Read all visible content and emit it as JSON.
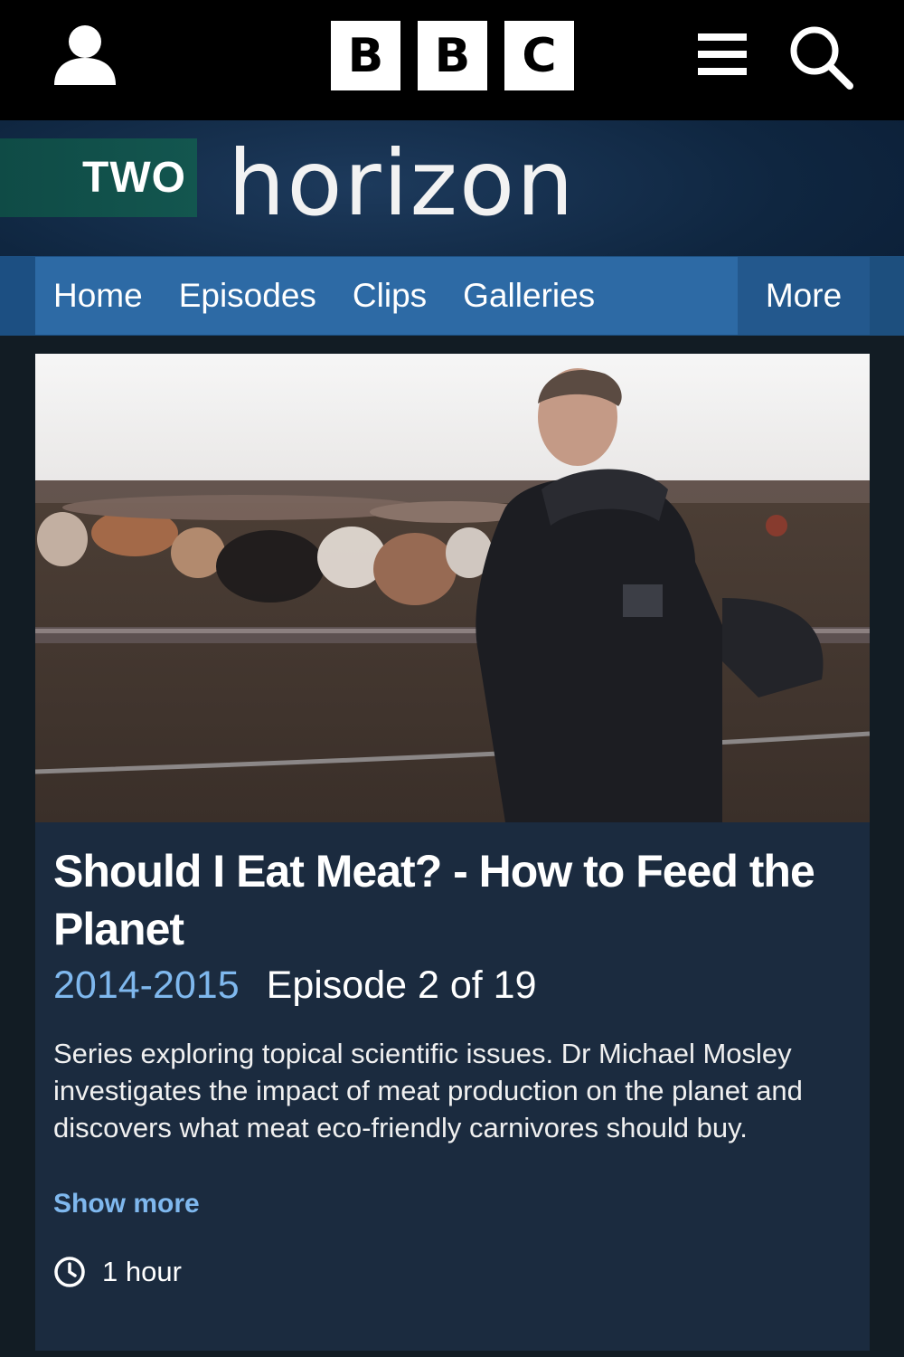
{
  "header": {
    "logo_letters": [
      "B",
      "B",
      "C"
    ],
    "icons": [
      "user-icon",
      "menu-icon",
      "search-icon"
    ]
  },
  "brand": {
    "channel": "TWO",
    "show_title": "horizon"
  },
  "nav": {
    "items": [
      {
        "label": "Home"
      },
      {
        "label": "Episodes"
      },
      {
        "label": "Clips"
      },
      {
        "label": "Galleries"
      }
    ],
    "more_label": "More"
  },
  "episode": {
    "title": "Should I Eat Meat? - How to Feed the Planet",
    "series": "2014-2015",
    "episode_number": "Episode 2 of 19",
    "description": "Series exploring topical scientific issues. Dr Michael Mosley investigates the impact of meat production on the planet and discovers what meat eco-friendly carnivores should buy.",
    "show_more_label": "Show more",
    "duration": "1 hour"
  },
  "colors": {
    "nav_bg": "#2d6aa5",
    "card_bg": "#1b2b3f",
    "accent": "#7fb8ee",
    "channel_badge": "#13564f"
  }
}
